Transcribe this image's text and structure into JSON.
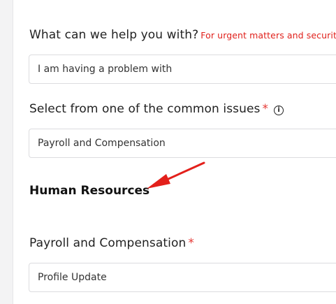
{
  "form": {
    "help": {
      "label": "What can we help you with?",
      "hint": "For urgent matters and securit",
      "value": "I am having a problem with"
    },
    "common": {
      "label": "Select from one of the common issues",
      "required_mark": "*",
      "info_icon_glyph": "i",
      "value": "Payroll and Compensation"
    },
    "section_title": "Human Resources",
    "payroll": {
      "label": "Payroll and Compensation",
      "required_mark": "*",
      "value": "Profile Update"
    }
  },
  "colors": {
    "required": "#e53935",
    "hint": "#e0201b",
    "arrow": "#e3201b",
    "field_border": "#dcdcdf"
  }
}
